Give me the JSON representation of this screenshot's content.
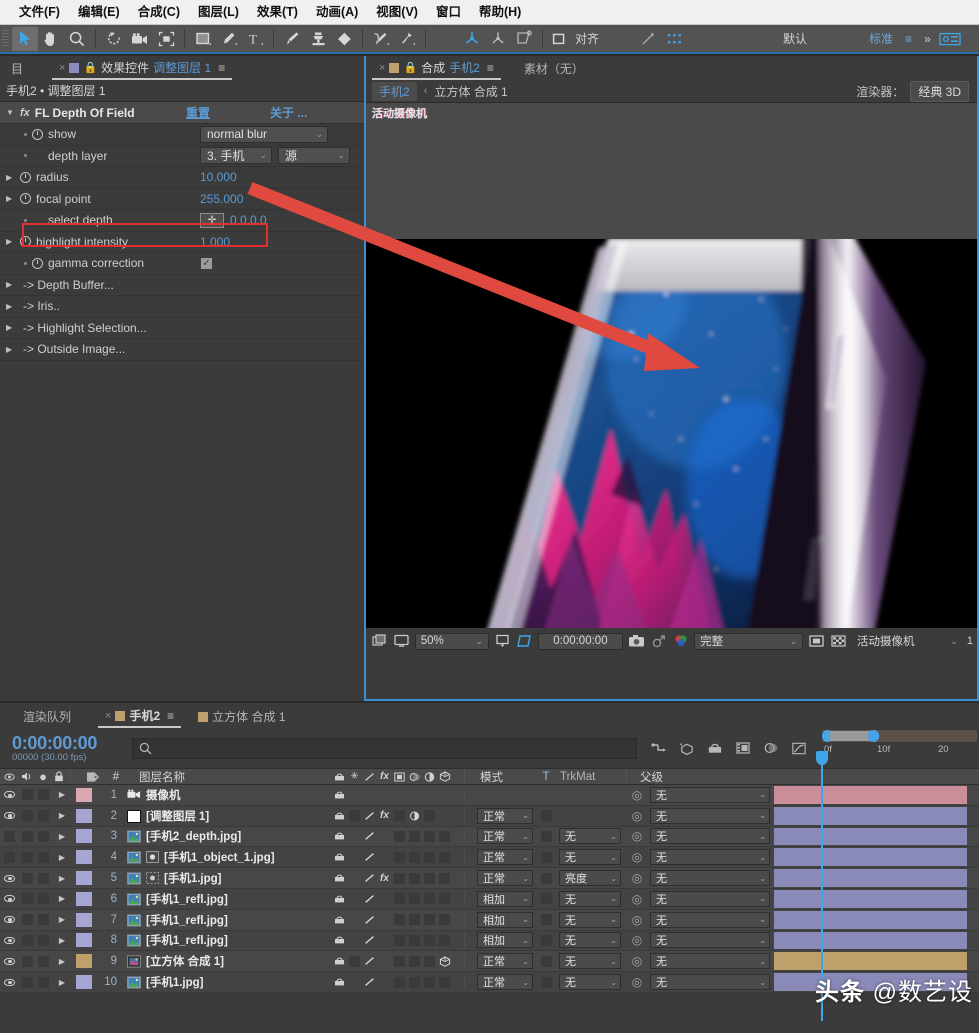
{
  "menubar": {
    "items": [
      {
        "label": "文件(F)"
      },
      {
        "label": "编辑(E)"
      },
      {
        "label": "合成(C)"
      },
      {
        "label": "图层(L)"
      },
      {
        "label": "效果(T)"
      },
      {
        "label": "动画(A)"
      },
      {
        "label": "视图(V)"
      },
      {
        "label": "窗口"
      },
      {
        "label": "帮助(H)"
      }
    ]
  },
  "toolbar": {
    "align_label": "对齐",
    "workspace_label": "默认",
    "workspace_current": "标准",
    "icons": [
      "selection-tool",
      "hand-tool",
      "zoom-tool",
      "rotation-tool",
      "camera-tool",
      "region-of-interest-tool",
      "shape-tool",
      "pen-tool",
      "text-tool",
      "brush-tool",
      "clone-stamp-tool",
      "eraser-tool",
      "roto-brush-tool",
      "puppet-pin-tool",
      "unified-camera-tool",
      "orbit-camera-tool",
      "pan-behind-tool",
      "align-icon",
      "anchor-snap-icon",
      "snapping-icon",
      "workspace-menu-icon",
      "chevron-double-right-icon",
      "settings-icon"
    ]
  },
  "effects_panel": {
    "tabs": [
      {
        "label": "目",
        "selected": false,
        "closable": false,
        "swatch": null
      },
      {
        "label": "效果控件",
        "accent": "调整图层 1",
        "selected": true,
        "closable": true,
        "swatch": "purple"
      }
    ],
    "breadcrumb": "手机2 • 调整图层 1",
    "effect": {
      "name": "FL Depth Of Field",
      "reset_label": "重置",
      "about_label": "关于 ...",
      "fx_icon": "fx-icon"
    },
    "properties": [
      {
        "name": "show",
        "type": "dropdown",
        "value": "normal blur",
        "stopwatch": true,
        "expandable": false
      },
      {
        "name": "depth layer",
        "type": "dropdown2",
        "value": "3. 手机",
        "value2": "源",
        "stopwatch": false,
        "expandable": false
      },
      {
        "name": "radius",
        "type": "number",
        "value": "10.000",
        "stopwatch": true,
        "expandable": true,
        "highlighted": true
      },
      {
        "name": "focal point",
        "type": "number",
        "value": "255.000",
        "stopwatch": true,
        "expandable": true
      },
      {
        "name": "select depth",
        "type": "point",
        "value": "0.0,0.0",
        "stopwatch": false,
        "expandable": false
      },
      {
        "name": "highlight intensity",
        "type": "number",
        "value": "1.000",
        "stopwatch": true,
        "expandable": true
      },
      {
        "name": "gamma correction",
        "type": "checkbox",
        "value": "✓",
        "stopwatch": true,
        "expandable": false
      },
      {
        "name": "-> Depth Buffer...",
        "type": "group",
        "expandable": true
      },
      {
        "name": "-> Iris..",
        "type": "group",
        "expandable": true
      },
      {
        "name": "-> Highlight Selection...",
        "type": "group",
        "expandable": true
      },
      {
        "name": "-> Outside Image...",
        "type": "group",
        "expandable": true
      }
    ]
  },
  "comp_panel": {
    "tabs": [
      {
        "label": "合成",
        "accent": "手机2",
        "selected": true,
        "closable": true,
        "swatch": "tan"
      },
      {
        "label": "素材（无）",
        "selected": false,
        "closable": false
      }
    ],
    "breadcrumb_chip": "手机2",
    "breadcrumb_tail": "立方体 合成 1",
    "renderer_label": "渲染器：",
    "renderer_value": "经典 3D",
    "viewer_label": "活动摄像机",
    "bottom_bar": {
      "zoom": "50%",
      "timecode": "0:00:00:00",
      "quality": "完整",
      "view": "活动摄像机",
      "views_count": "1",
      "icons": [
        "toggle-transparency-grid-icon",
        "monitor-icon",
        "region-of-interest-icon",
        "mask-icon",
        "snapshot-icon",
        "show-snapshot-icon",
        "channel-icon",
        "renderer-quality-icon",
        "transparency-icon"
      ]
    }
  },
  "timeline": {
    "tabs": [
      {
        "label": "渲染队列",
        "selected": false,
        "closable": false,
        "swatch": null
      },
      {
        "label": "手机2",
        "selected": true,
        "closable": true,
        "swatch": "tan"
      },
      {
        "label": "立方体 合成 1",
        "selected": false,
        "closable": false,
        "swatch": "tan"
      }
    ],
    "timecode": "0:00:00:00",
    "frame_info": "00000 (30.00 fps)",
    "search_placeholder": "",
    "ruler_ticks": [
      "0f",
      "10f",
      "20"
    ],
    "columns": {
      "eye": "visibility",
      "audio": "audio",
      "solo": "solo",
      "lock": "lock",
      "label": "label",
      "number": "#",
      "name": "图层名称",
      "mode": "模式",
      "t": "T",
      "trkmat": "TrkMat",
      "parent": "父级"
    },
    "layers": [
      {
        "num": "1",
        "name": "摄像机",
        "visible": true,
        "color": "#d9a8b0",
        "type": "camera",
        "mode": "",
        "trkmat": "",
        "parent": "无",
        "bar_color": "#c98e9a"
      },
      {
        "num": "2",
        "name": "[调整图层 1]",
        "visible": true,
        "color": "#a6a6d4",
        "type": "solid",
        "mode": "正常",
        "trkmat": "",
        "parent": "无",
        "bar_color": "#8a8ab8"
      },
      {
        "num": "3",
        "name": "[手机2_depth.jpg]",
        "visible": false,
        "color": "#a6a6d4",
        "type": "image",
        "mode": "正常",
        "trkmat": "无",
        "parent": "无",
        "bar_color": "#8a8ab8"
      },
      {
        "num": "4",
        "name": "[手机1_object_1.jpg]",
        "visible": false,
        "color": "#a6a6d4",
        "type": "image",
        "mode": "正常",
        "trkmat": "无",
        "parent": "无",
        "bar_color": "#8a8ab8"
      },
      {
        "num": "5",
        "name": "[手机1.jpg]",
        "visible": true,
        "color": "#a6a6d4",
        "type": "image",
        "mode": "正常",
        "trkmat": "亮度",
        "parent": "无",
        "bar_color": "#8a8ab8"
      },
      {
        "num": "6",
        "name": "[手机1_refl.jpg]",
        "visible": true,
        "color": "#a6a6d4",
        "type": "image",
        "mode": "相加",
        "trkmat": "无",
        "parent": "无",
        "bar_color": "#8a8ab8"
      },
      {
        "num": "7",
        "name": "[手机1_refl.jpg]",
        "visible": true,
        "color": "#a6a6d4",
        "type": "image",
        "mode": "相加",
        "trkmat": "无",
        "parent": "无",
        "bar_color": "#8a8ab8"
      },
      {
        "num": "8",
        "name": "[手机1_refl.jpg]",
        "visible": true,
        "color": "#a6a6d4",
        "type": "image",
        "mode": "相加",
        "trkmat": "无",
        "parent": "无",
        "bar_color": "#8a8ab8"
      },
      {
        "num": "9",
        "name": "[立方体 合成 1]",
        "visible": true,
        "color": "#bfa06a",
        "type": "comp",
        "mode": "正常",
        "trkmat": "无",
        "parent": "无",
        "bar_color": "#bfa06a"
      },
      {
        "num": "10",
        "name": "[手机1.jpg]",
        "visible": true,
        "color": "#a6a6d4",
        "type": "image",
        "mode": "正常",
        "trkmat": "无",
        "parent": "无",
        "bar_color": "#8a8ab8"
      }
    ]
  },
  "watermark": {
    "prefix": "头条",
    "suffix": "@数艺设"
  },
  "colors": {
    "accent_blue": "#5a9bd5",
    "panel_bg": "#3b3b3b",
    "highlight_red": "#e03030",
    "selected_border": "#3c8fd0"
  }
}
